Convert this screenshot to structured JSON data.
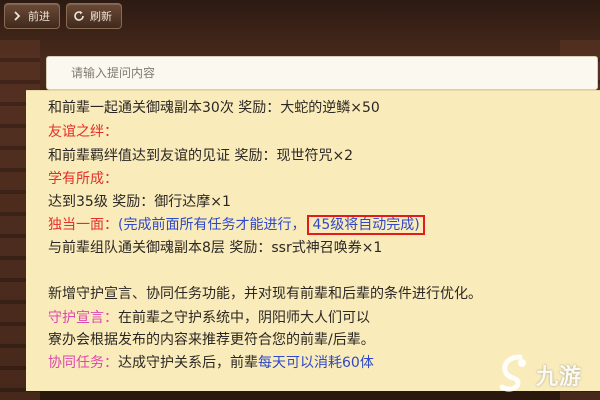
{
  "toolbar": {
    "back_label": "前进",
    "back_icon": "chevron-right-icon",
    "refresh_label": "刷新",
    "refresh_icon": "refresh-icon"
  },
  "search": {
    "placeholder": "请输入提问内容"
  },
  "content": {
    "line1": "和前辈一起通关御魂副本30次 奖励：大蛇的逆鳞×50",
    "friendship_title": "友谊之绊：",
    "line2": "和前辈羁绊值达到友谊的见证 奖励：现世符咒×2",
    "learned_title": "学有所成：",
    "line3": "达到35级 奖励：御行达摩×1",
    "solo_title": "独当一面：",
    "solo_note": "(完成前面所有任务才能进行，",
    "solo_highlight": "45级将自动完成)",
    "line4": "与前辈组队通关御魂副本8层 奖励：ssr式神召唤券×1",
    "para": "新增守护宣言、协同任务功能，并对现有前辈和后辈的条件进行优化。",
    "guard_title": "守护宣言：",
    "guard_text": "在前辈之守护系统中，阴阳师大人们可以",
    "line5": "寮办会根据发布的内容来推荐更符合您的前辈/后辈。",
    "coop_title": "协同任务：",
    "coop_text": "达成守护关系后，前辈",
    "coop_blue": "每天可以消耗60体"
  },
  "watermark": {
    "text": "九游",
    "icon": "jiuyou-logo-icon"
  },
  "colors": {
    "panel_bg": "#f9ebba",
    "red_heading": "#e2302a",
    "pink_heading": "#e047b0",
    "blue_text": "#2f49c8",
    "highlight_border": "#e31b1b"
  }
}
